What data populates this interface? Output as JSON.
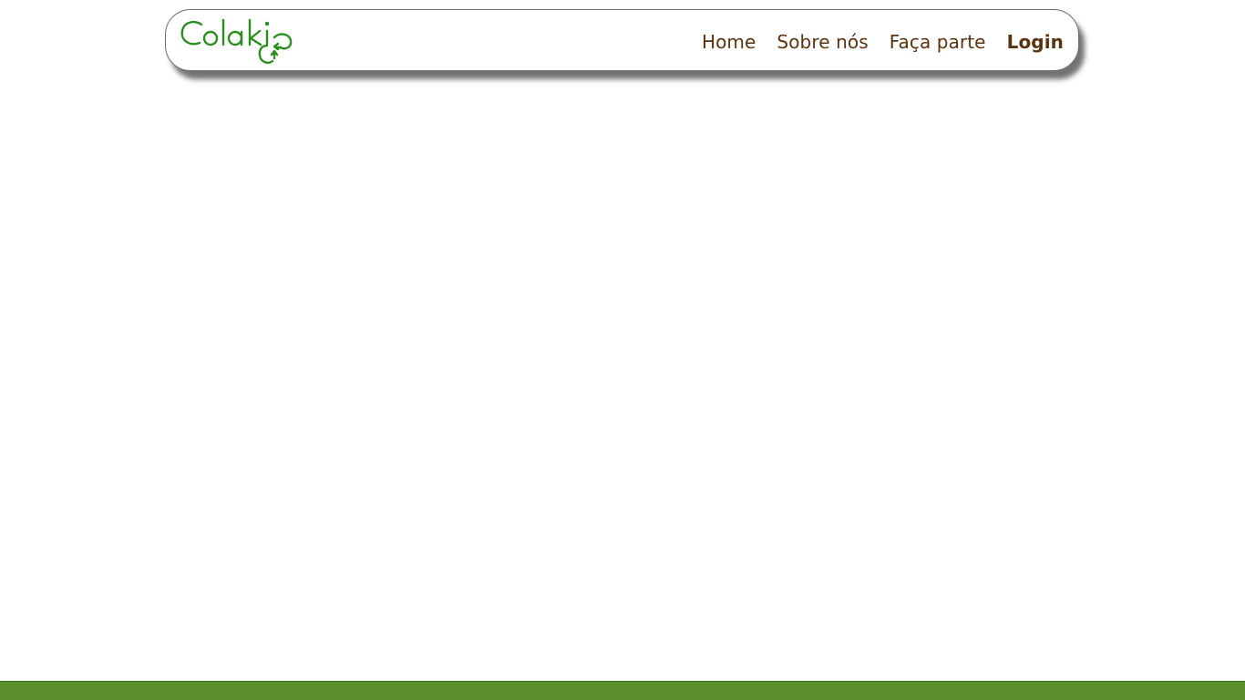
{
  "brand": {
    "logo_text": "Colaki",
    "logo_color": "#2a8f1e"
  },
  "nav": {
    "items": [
      {
        "label": "Home"
      },
      {
        "label": "Sobre nós"
      },
      {
        "label": "Faça parte"
      },
      {
        "label": "Login"
      }
    ],
    "link_color": "#5a3310"
  },
  "footer": {
    "color": "#5a8f2b"
  }
}
